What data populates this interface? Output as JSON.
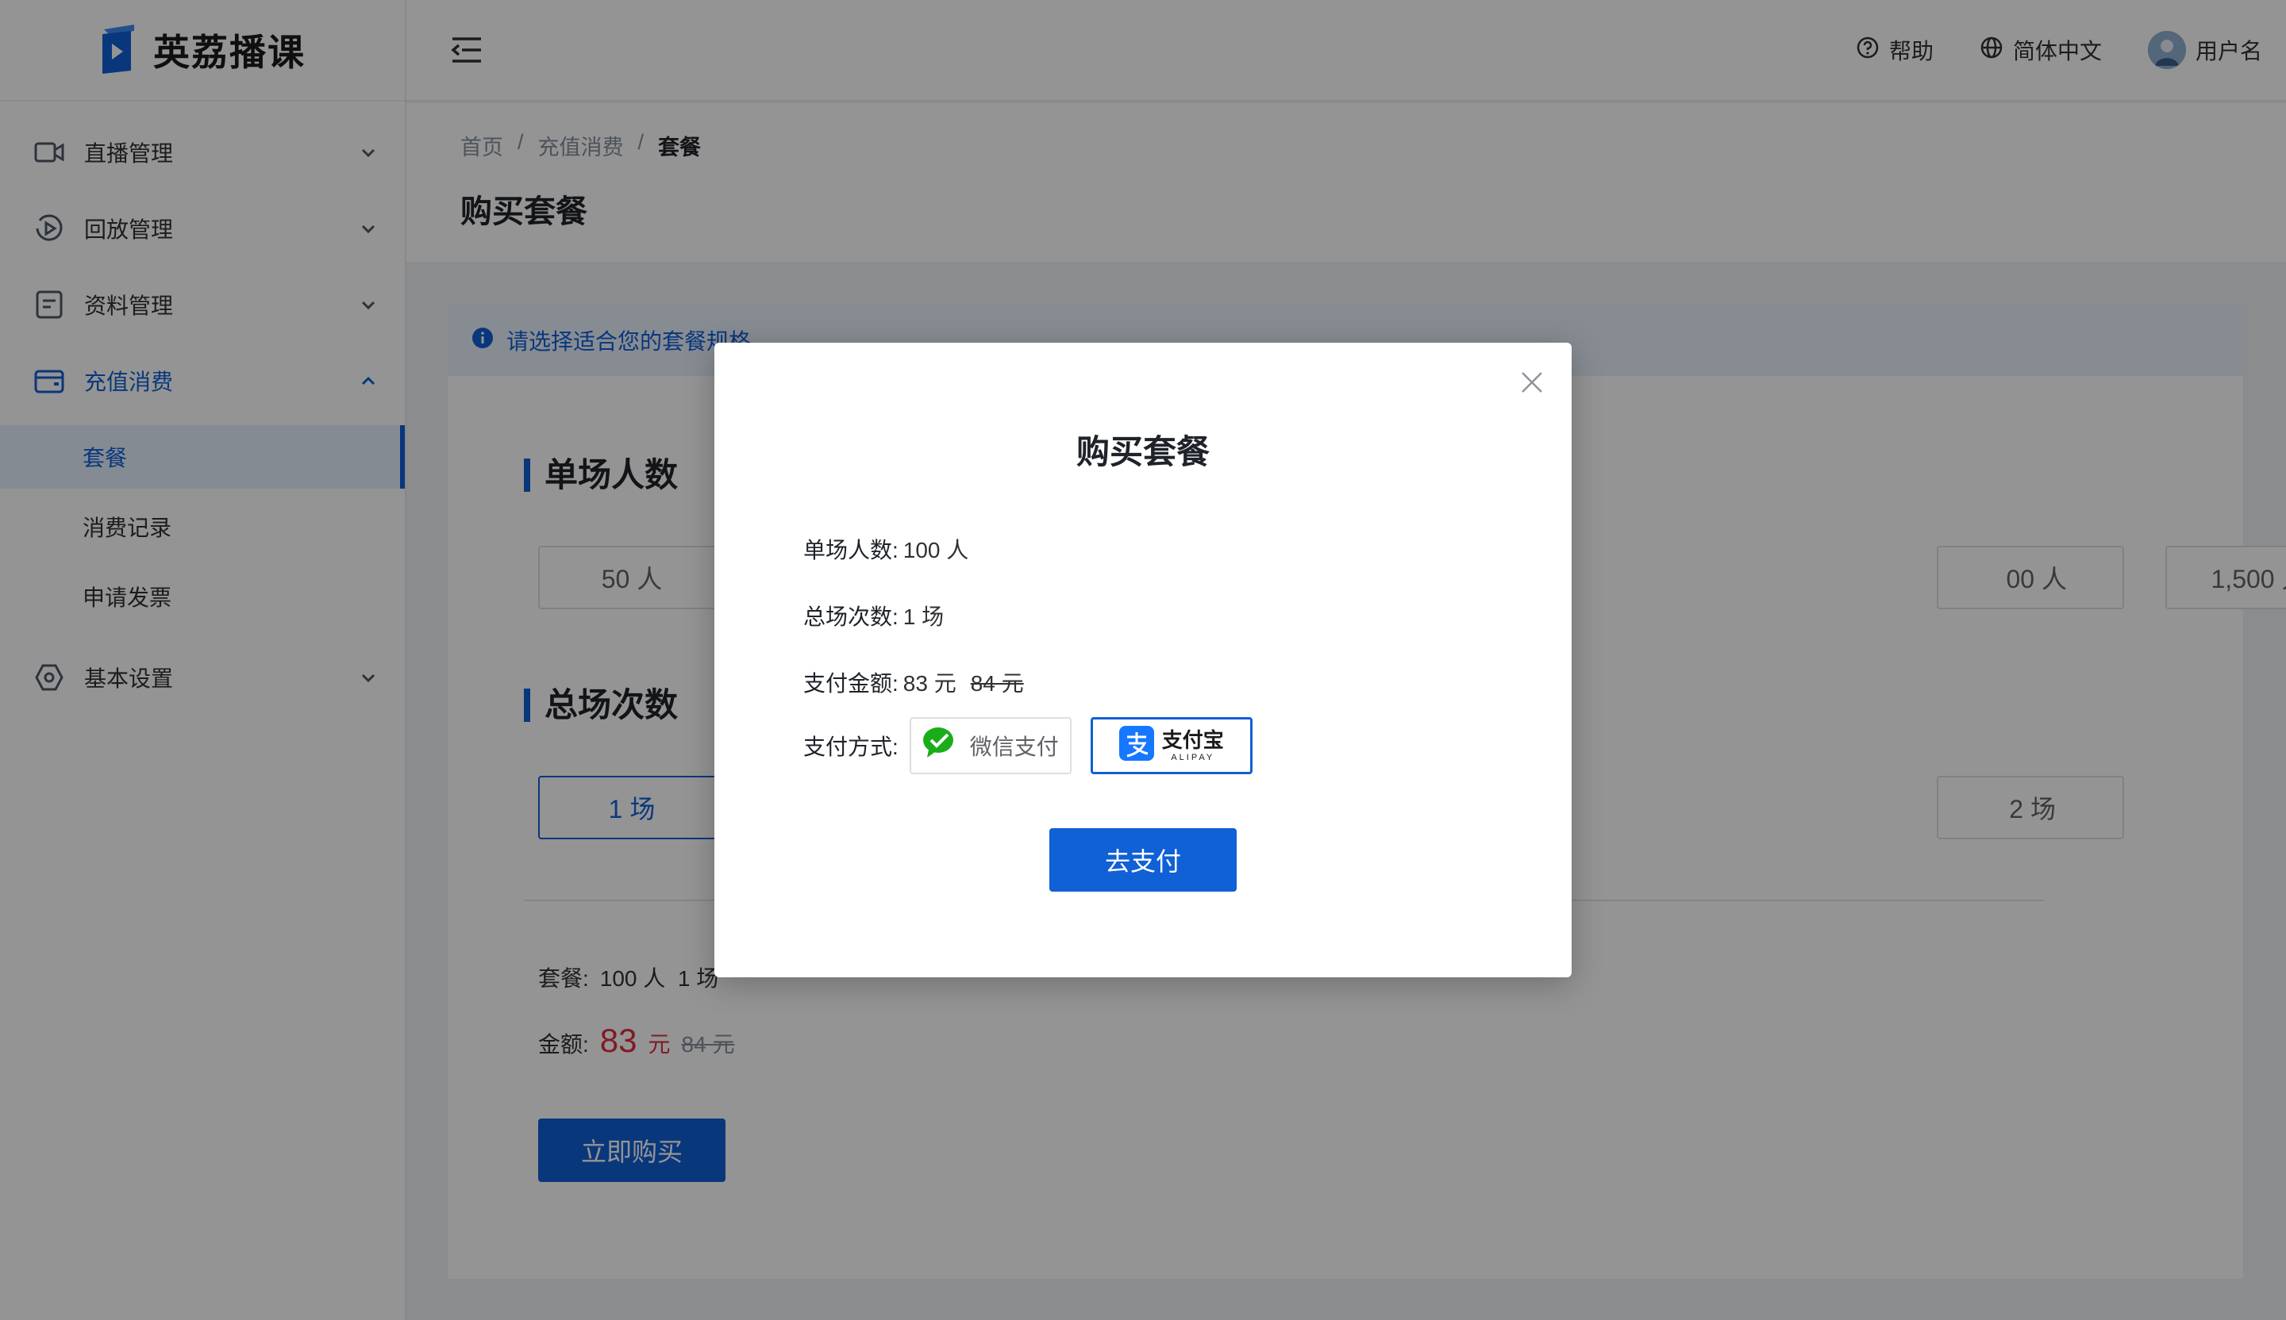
{
  "app": {
    "name": "英荔播课"
  },
  "sidebar": {
    "items": [
      {
        "label": "直播管理",
        "icon": "video-camera-icon"
      },
      {
        "label": "回放管理",
        "icon": "replay-icon"
      },
      {
        "label": "资料管理",
        "icon": "document-icon"
      },
      {
        "label": "充值消费",
        "icon": "wallet-icon"
      },
      {
        "label": "基本设置",
        "icon": "settings-icon"
      }
    ],
    "sub_items": [
      {
        "label": "套餐"
      },
      {
        "label": "消费记录"
      },
      {
        "label": "申请发票"
      }
    ]
  },
  "header": {
    "help": "帮助",
    "language": "简体中文",
    "username": "用户名"
  },
  "breadcrumb": [
    "首页",
    "/",
    "充值消费",
    "/",
    "套餐"
  ],
  "page": {
    "title": "购买套餐",
    "alert": "请选择适合您的套餐规格",
    "section_people": "单场人数",
    "section_sessions": "总场次数",
    "people_options": [
      "50 人",
      "00 人",
      "1,500 人"
    ],
    "session_options": [
      "1 场",
      "2 场"
    ],
    "summary_label": "套餐:",
    "summary_value": "100 人  1 场",
    "amount_label": "金额:",
    "amount_price": "83",
    "amount_unit": "元",
    "amount_original": "84 元",
    "buy_button": "立即购买"
  },
  "modal": {
    "title": "购买套餐",
    "people_label": "单场人数:",
    "people_value": "100 人",
    "sessions_label": "总场次数:",
    "sessions_value": "1 场",
    "amount_label": "支付金额:",
    "amount_value": "83 元",
    "amount_original": "84 元",
    "method_label": "支付方式:",
    "wechat_label": "微信支付",
    "alipay_label": "支付宝",
    "alipay_sub": "ALIPAY",
    "pay_button": "去支付"
  },
  "colors": {
    "primary": "#1060d6",
    "price": "#e02e3e",
    "wechat": "#1aad19",
    "alipay": "#1677ff"
  }
}
